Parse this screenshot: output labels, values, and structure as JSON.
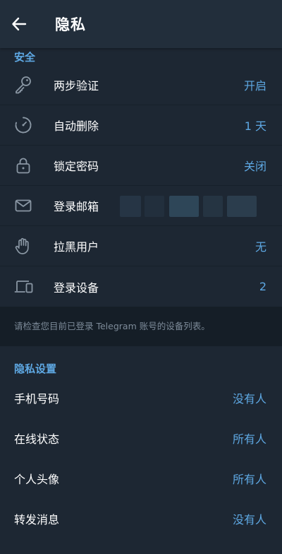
{
  "header": {
    "title": "隐私"
  },
  "security": {
    "title": "安全",
    "items": [
      {
        "label": "两步验证",
        "value": "开启",
        "icon": "key-icon"
      },
      {
        "label": "自动删除",
        "value": "1 天",
        "icon": "timer-icon"
      },
      {
        "label": "锁定密码",
        "value": "关闭",
        "icon": "lock-icon"
      },
      {
        "label": "登录邮箱",
        "value": "",
        "icon": "mail-icon"
      },
      {
        "label": "拉黑用户",
        "value": "无",
        "icon": "hand-icon"
      },
      {
        "label": "登录设备",
        "value": "2",
        "icon": "devices-icon"
      }
    ],
    "note": "请检查您目前已登录 Telegram 账号的设备列表。"
  },
  "privacy": {
    "title": "隐私设置",
    "items": [
      {
        "label": "手机号码",
        "value": "没有人"
      },
      {
        "label": "在线状态",
        "value": "所有人"
      },
      {
        "label": "个人头像",
        "value": "所有人"
      },
      {
        "label": "转发消息",
        "value": "没有人"
      }
    ]
  },
  "colors": {
    "accent": "#5ea8e3",
    "background": "#1d2733",
    "header": "#222e3b"
  }
}
